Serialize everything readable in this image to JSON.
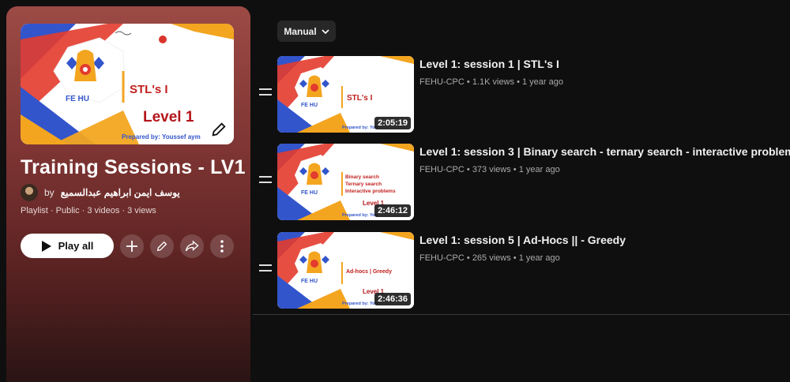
{
  "playlist": {
    "hero_thumbnail": {
      "logo_text": "FE HU",
      "title": "STL's I",
      "level": "Level 1",
      "prepared_by": "Prepared by: Youssef aym"
    },
    "title": "Training Sessions - LV1",
    "by_label": "by",
    "owner_name": "يوسف ايمن ابراهيم عبدالسميع",
    "meta": "Playlist · Public · 3 videos · 3 views",
    "play_all_label": "Play all"
  },
  "sort": {
    "label": "Manual"
  },
  "videos": [
    {
      "title": "Level 1: session 1 | STL's I",
      "channel": "FEHU-CPC",
      "views": "1.1K views",
      "age": "1 year ago",
      "duration": "2:05:19",
      "thumb_lines": [
        "STL's I"
      ],
      "thumb_level": "Level 1",
      "thumb_prepared": "Prepared by: You"
    },
    {
      "title": "Level 1: session 3 | Binary search - ternary search - interactive problems",
      "channel": "FEHU-CPC",
      "views": "373 views",
      "age": "1 year ago",
      "duration": "2:46:12",
      "thumb_lines": [
        "Binary search",
        "Ternary search",
        "Interactive problems"
      ],
      "thumb_level": "Level 1",
      "thumb_prepared": "Prepared by: You"
    },
    {
      "title": "Level 1: session 5 | Ad-Hocs || - Greedy",
      "channel": "FEHU-CPC",
      "views": "265 views",
      "age": "1 year ago",
      "duration": "2:46:36",
      "thumb_lines": [
        "Ad-hocs | Greedy"
      ],
      "thumb_level": "Level 1",
      "thumb_prepared": "Prepared by: You"
    }
  ],
  "colors": {
    "panel_top": "#9d4a45",
    "panel_bottom": "#2a1414",
    "accent_red": "#c0201e",
    "accent_blue": "#3355cc",
    "accent_orange": "#f3a520"
  }
}
